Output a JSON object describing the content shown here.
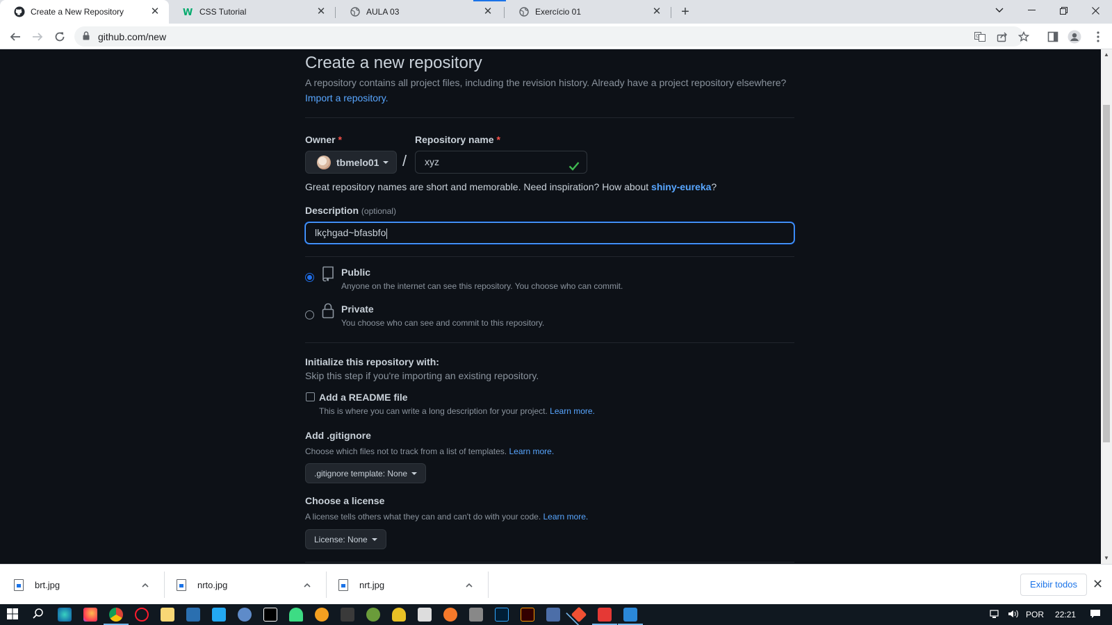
{
  "browser": {
    "tabs": [
      {
        "title": "Create a New Repository",
        "favicon": "github-icon",
        "active": true
      },
      {
        "title": "CSS Tutorial",
        "favicon": "w3schools-icon",
        "active": false
      },
      {
        "title": "AULA 03",
        "favicon": "globe-icon",
        "active": false
      },
      {
        "title": "Exercício 01",
        "favicon": "globe-icon",
        "active": false
      }
    ],
    "url": "github.com/new"
  },
  "page": {
    "title": "Create a new repository",
    "lead": "A repository contains all project files, including the revision history. Already have a project repository elsewhere?",
    "import_link": "Import a repository.",
    "owner_label": "Owner",
    "required_mark": "*",
    "owner_value": "tbmelo01",
    "slash": "/",
    "repo_label": "Repository name",
    "repo_value": "xyz",
    "hint_text": "Great repository names are short and memorable. Need inspiration? How about ",
    "hint_suggestion": "shiny-eureka",
    "hint_end": "?",
    "description_label": "Description",
    "description_optional": "(optional)",
    "description_value": "lkçhgad~bfasbfo",
    "visibility": [
      {
        "title": "Public",
        "note": "Anyone on the internet can see this repository. You choose who can commit.",
        "selected": true,
        "icon": "repo-icon"
      },
      {
        "title": "Private",
        "note": "You choose who can see and commit to this repository.",
        "selected": false,
        "icon": "lock-icon"
      }
    ],
    "init_title": "Initialize this repository with:",
    "init_note": "Skip this step if you're importing an existing repository.",
    "readme_label": "Add a README file",
    "readme_note": "This is where you can write a long description for your project.",
    "learn_more": "Learn more.",
    "gitignore_title": "Add .gitignore",
    "gitignore_note": "Choose which files not to track from a list of templates.",
    "gitignore_button": ".gitignore template: None",
    "license_title": "Choose a license",
    "license_note": "A license tells others what they can and can't do with your code.",
    "license_button": "License: None"
  },
  "downloads": {
    "items": [
      "brt.jpg",
      "nrto.jpg",
      "nrt.jpg"
    ],
    "show_all": "Exibir todos"
  },
  "taskbar": {
    "language": "POR",
    "time": "22:21"
  },
  "colors": {
    "page_bg": "#0d1117",
    "accent_link": "#58a6ff",
    "required": "#f85149",
    "success": "#3fb950"
  }
}
